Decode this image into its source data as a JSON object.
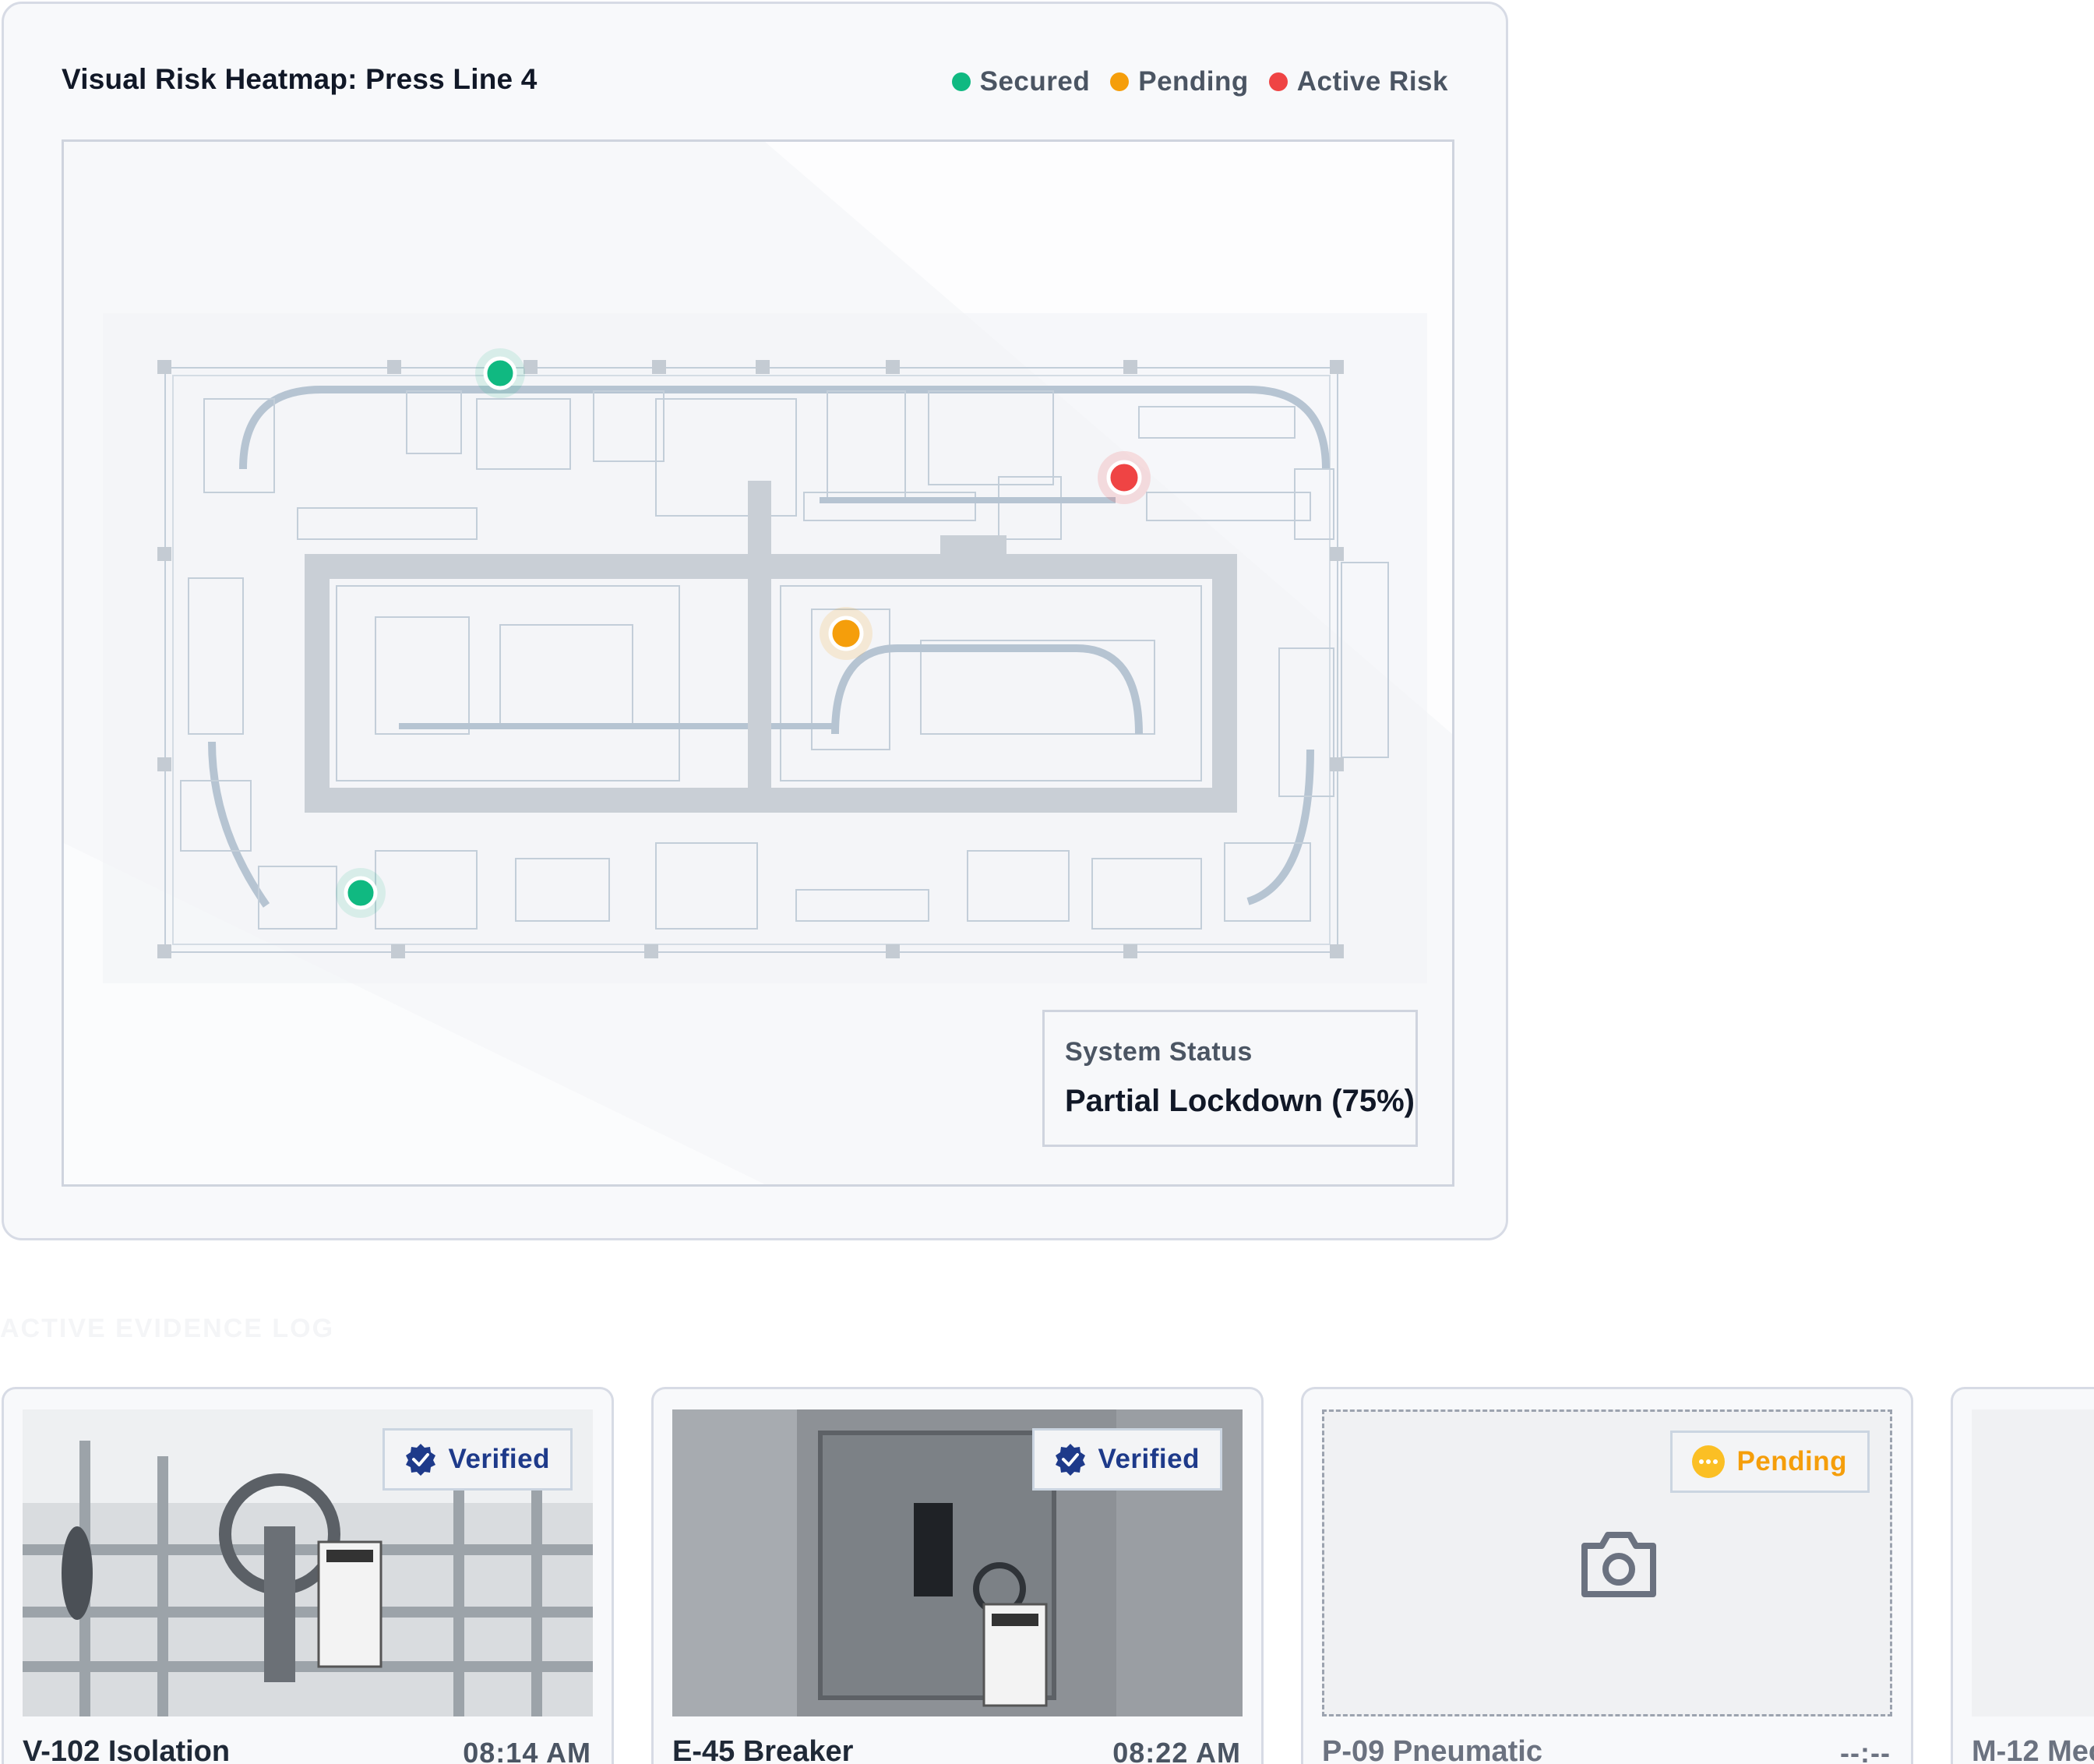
{
  "heatmap": {
    "title": "Visual Risk Heatmap: Press Line 4",
    "legend": [
      {
        "label": "Secured",
        "color": "#10b981"
      },
      {
        "label": "Pending",
        "color": "#f59e0b"
      },
      {
        "label": "Active Risk",
        "color": "#ef4444"
      }
    ],
    "status": {
      "label": "System Status",
      "value": "Partial Lockdown (75%)"
    }
  },
  "section_heading": "ACTIVE EVIDENCE LOG",
  "cards": [
    {
      "title": "V-102 Isolation",
      "time": "08:14 AM",
      "badge": "Verified",
      "badge_icon": "verified-check-icon"
    },
    {
      "title": "E-45 Breaker",
      "time": "08:22 AM",
      "badge": "Verified",
      "badge_icon": "verified-check-icon"
    },
    {
      "title": "P-09 Pneumatic",
      "time": "--:--",
      "badge": "Pending",
      "badge_icon": "pending-dots-icon",
      "photo_icon": "camera-icon"
    },
    {
      "title": "M-12 Mec"
    }
  ]
}
